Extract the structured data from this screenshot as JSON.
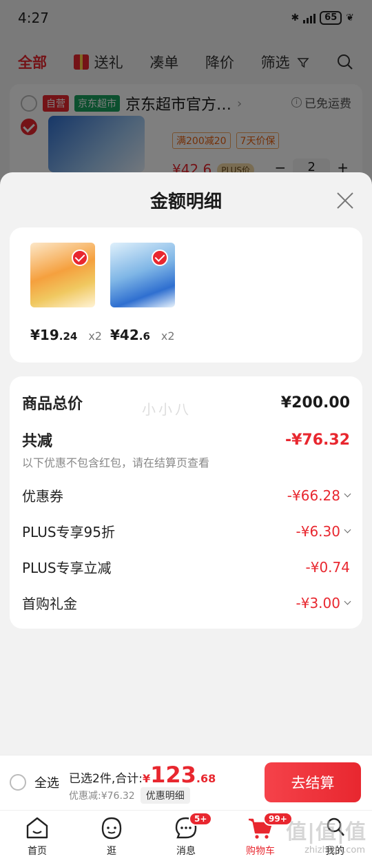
{
  "status_bar": {
    "time": "4:27",
    "battery": "65"
  },
  "top_tabs": [
    "全部",
    "送礼",
    "凑单",
    "降价",
    "筛选"
  ],
  "store": {
    "tag_self": "自营",
    "tag_market": "京东超市",
    "name": "京东超市官方…",
    "shipping": "已免运费",
    "promos": [
      "满200减20",
      "7天价保"
    ],
    "price": "¥42.6",
    "plus_tag": "PLUS价",
    "quantity": "2"
  },
  "sheet": {
    "title": "金额明细",
    "products": [
      {
        "price_main": "¥19",
        "price_decimal": ".24",
        "qty": "x2"
      },
      {
        "price_main": "¥42",
        "price_decimal": ".6",
        "qty": "x2"
      }
    ],
    "watermark": "小小八",
    "total_label": "商品总价",
    "total_value": "¥200.00",
    "discount_label": "共减",
    "discount_value": "-¥76.32",
    "discount_note": "以下优惠不包含红包，请在结算页查看",
    "lines": [
      {
        "label": "优惠券",
        "value": "-¥66.28"
      },
      {
        "label": "PLUS专享95折",
        "value": "-¥6.30"
      },
      {
        "label": "PLUS专享立减",
        "value": "-¥0.74"
      },
      {
        "label": "首购礼金",
        "value": "-¥3.00"
      }
    ]
  },
  "footer": {
    "select_all": "全选",
    "selected_text": "已选2件,合计:",
    "currency": "¥",
    "total_int": "123",
    "total_dec": ".68",
    "saved_text": "优惠减:¥76.32",
    "detail_button": "优惠明细",
    "checkout": "去结算"
  },
  "tabbar": {
    "items": [
      "首页",
      "逛",
      "消息",
      "购物车",
      "我的"
    ],
    "message_badge": "5+",
    "cart_badge": "99+"
  },
  "site_watermark": "值|值|值",
  "site_watermark_small": "zhizhizhi.com",
  "colors": {
    "accent": "#e8272f",
    "green": "#19a15f",
    "sheet_bg": "#f2f2f2"
  }
}
